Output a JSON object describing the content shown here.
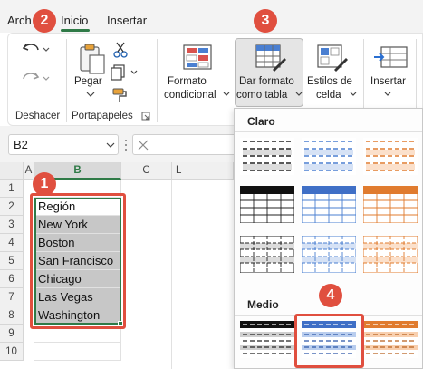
{
  "tabs": [
    "Arch",
    "Inicio",
    "Insertar"
  ],
  "ribbon": {
    "undo_group": "Deshacer",
    "clipboard_group": "Portapapeles",
    "paste_label": "Pegar",
    "formato_condicional": [
      "Formato",
      "condicional"
    ],
    "dar_formato": [
      "Dar formato",
      "como tabla"
    ],
    "estilos_celda": [
      "Estilos de",
      "celda"
    ],
    "insertar": "Insertar"
  },
  "formula_bar": {
    "name_box": "B2"
  },
  "grid": {
    "columns": [
      "A",
      "B",
      "C",
      "L"
    ],
    "rows": [
      "1",
      "2",
      "3",
      "4",
      "5",
      "6",
      "7",
      "8",
      "9",
      "10"
    ],
    "cells": [
      "Región",
      "New York",
      "Boston",
      "San Francisco",
      "Chicago",
      "Las Vegas",
      "Washington"
    ]
  },
  "dropdown": {
    "light_label": "Claro",
    "medium_label": "Medio"
  },
  "badges": [
    "1",
    "2",
    "3",
    "4"
  ],
  "colors": {
    "accent": "#2f7a47",
    "badge": "#e04f3f",
    "selection": "#c7c7c7"
  }
}
